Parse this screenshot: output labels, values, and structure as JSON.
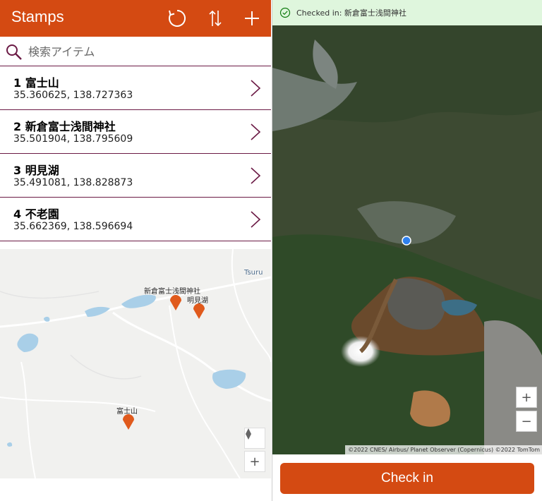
{
  "app": {
    "title": "Stamps",
    "accent_color": "#d44a12",
    "divider_color": "#6b1a45"
  },
  "header": {
    "refresh_icon": "refresh-icon",
    "sort_icon": "sort-icon",
    "add_icon": "add-icon"
  },
  "search": {
    "placeholder": "検索アイテム",
    "value": ""
  },
  "list": {
    "items": [
      {
        "title": "1 富士山",
        "coords": "35.360625, 138.727363"
      },
      {
        "title": "2 新倉富士浅間神社",
        "coords": "35.501904, 138.795609"
      },
      {
        "title": "3 明見湖",
        "coords": "35.491081, 138.828873"
      },
      {
        "title": "4 不老園",
        "coords": "35.662369, 138.596694"
      }
    ]
  },
  "left_map": {
    "town_label": "Tsuru",
    "pins": [
      {
        "label": "新倉富士浅間神社"
      },
      {
        "label": "明見湖"
      },
      {
        "label": "富士山"
      }
    ],
    "compass_icon": "compass-icon",
    "zoom_in_label": "+"
  },
  "right": {
    "status_text": "Checked in: 新倉富士浅間神社",
    "status_color": "#dff6dd",
    "zoom_in_label": "+",
    "zoom_out_label": "−",
    "attribution": "©2022 CNES/ Airbus/ Planet Observer (Copernicus) ©2022 TomTom",
    "checkin_label": "Check in"
  }
}
